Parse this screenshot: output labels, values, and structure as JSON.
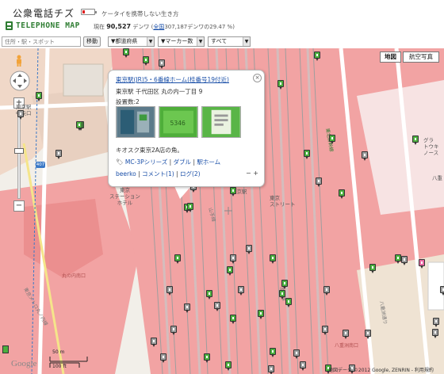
{
  "header": {
    "site_title": "公衆電話チズ",
    "tagline": "ケータイを携帯しない生き方",
    "brand": "TELEPHONE MAP",
    "stats_prefix": "現在",
    "count": "90,527",
    "stats_unit": "デンワ",
    "total_link": "全国",
    "total_rest": "307,187デンワの29.47 %",
    "stats_close": ")"
  },
  "toolbar": {
    "search_placeholder": "住所・駅・スポット",
    "move_button": "移動",
    "prefecture_select": "▼都道府県",
    "marker_select": "▼マーカー数",
    "all_select": "すべて"
  },
  "map": {
    "type_map": "地図",
    "type_aerial": "航空写真",
    "zoom_in": "+",
    "zoom_out": "−",
    "labels": {
      "tokyo_station_chuo": "東京駅\n中央口",
      "tokyo_station_hotel": "東京\nステーション\nホテル",
      "tokyo_station": "東京駅",
      "tokyo_street": "東京\nストリート",
      "gran": "グラ\nトウキ\nノース",
      "yaesu": "八重",
      "marunouchi_south": "丸の内南口",
      "tokyo_metro": "東京メトロ丸ノ内線",
      "yaesu_south": "八重洲南口",
      "nihonbashi": "八重洲通り",
      "keiyo": "京葉線",
      "jr_yamanote": "山手線",
      "shinkansen": "東北新幹線"
    },
    "route_shield": "407",
    "scale_m": "50 m",
    "scale_ft": "100 ft",
    "google": "Google",
    "copyright": "地図データ ©2012 Google, ZENRIN - 利用規約"
  },
  "popup": {
    "title": "東京駅(JR)5・6番線ホーム(桂番号19付近)",
    "address": "東京駅 千代田区 丸の内一丁目 9",
    "count": "設置数:2",
    "description": "キオスク東京2A店の角。",
    "tags_prefix": "🏷",
    "tag1": "MC-3Pシリーズ",
    "tag2": "ダブル",
    "tag3": "駅ホーム",
    "user": "beerko",
    "comments": "コメント(1)",
    "logs": "ログ(2)",
    "zoom_controls": "− +"
  },
  "colors": {
    "accent_green": "#4caf3f",
    "link_blue": "#1a4fa8",
    "rail_pink": "#f2a3a3"
  }
}
